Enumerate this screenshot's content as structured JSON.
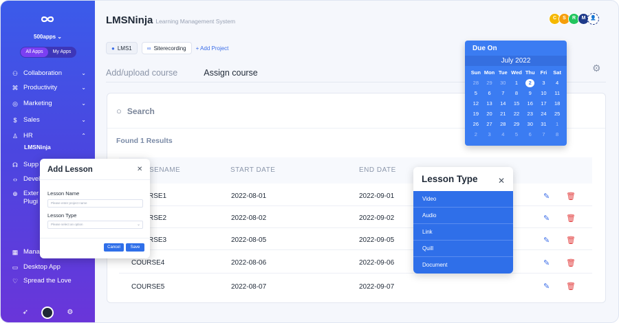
{
  "sidebar": {
    "org_name": "500apps",
    "app_tabs": [
      "All Apps",
      "My Apps"
    ],
    "items": [
      {
        "label": "Collaboration",
        "icon": "network-icon"
      },
      {
        "label": "Productivity",
        "icon": "command-icon"
      },
      {
        "label": "Marketing",
        "icon": "target-icon"
      },
      {
        "label": "Sales",
        "icon": "dollar-icon"
      },
      {
        "label": "HR",
        "icon": "person-icon"
      },
      {
        "label": "Supp",
        "icon": "headset-icon"
      },
      {
        "label": "Devel",
        "icon": "code-icon"
      },
      {
        "label": "Exter",
        "label2": "Plugi",
        "icon": "globe-icon"
      },
      {
        "label": "Mana",
        "icon": "grid-icon"
      },
      {
        "label": "Desktop App",
        "icon": "monitor-icon"
      },
      {
        "label": "Spread the Love",
        "icon": "heart-icon"
      }
    ],
    "sub_item": "LMSNinja"
  },
  "header": {
    "title": "LMSNinja",
    "subtitle": "Learning Management System",
    "avatars": [
      {
        "letter": "C",
        "color": "#f5b800"
      },
      {
        "letter": "S",
        "color": "#f59e0b"
      },
      {
        "letter": "R",
        "color": "#22c55e"
      },
      {
        "letter": "M",
        "color": "#1e3a8a"
      }
    ]
  },
  "projects": {
    "chips": [
      "LMS1",
      "Siterecording"
    ],
    "add_label": "+ Add Project"
  },
  "tabs": [
    "Add/upload course",
    "Assign course"
  ],
  "search": {
    "placeholder": "Search"
  },
  "results_label": "Found 1 Results",
  "table": {
    "columns": [
      "SENAME",
      "START DATE",
      "END DATE"
    ],
    "rows": [
      {
        "name": "RSE1",
        "start": "2022-08-01",
        "end": "2022-09-01"
      },
      {
        "name": "RSE2",
        "start": "2022-08-02",
        "end": "2022-09-02"
      },
      {
        "name": "RSE3",
        "start": "2022-08-05",
        "end": "2022-09-05"
      },
      {
        "name": "COURSE4",
        "start": "2022-08-06",
        "end": "2022-09-06"
      },
      {
        "name": "COURSE5",
        "start": "2022-08-07",
        "end": "2022-09-07"
      }
    ]
  },
  "calendar": {
    "title": "Due On",
    "month": "July 2022",
    "weekdays": [
      "Sun",
      "Mon",
      "Tue",
      "Wed",
      "Thu",
      "Fri",
      "Sat"
    ],
    "days": [
      "28",
      "29",
      "30",
      "1",
      "2",
      "3",
      "4",
      "5",
      "6",
      "7",
      "8",
      "9",
      "10",
      "11",
      "12",
      "13",
      "14",
      "15",
      "16",
      "17",
      "18",
      "19",
      "20",
      "21",
      "22",
      "23",
      "24",
      "25",
      "26",
      "27",
      "28",
      "29",
      "30",
      "31",
      "1",
      "2",
      "3",
      "4",
      "5",
      "6",
      "7",
      "8"
    ],
    "selected": "2"
  },
  "lesson_type": {
    "title": "Lesson Type",
    "options": [
      "Video",
      "Audio",
      "Link",
      "Quill",
      "Document"
    ]
  },
  "add_lesson": {
    "title": "Add Lesson",
    "name_label": "Lesson Name",
    "name_placeholder": "Please enter project name",
    "type_label": "Lesson Type",
    "type_placeholder": "Please select an option",
    "cancel": "Cancel",
    "save": "Save"
  }
}
